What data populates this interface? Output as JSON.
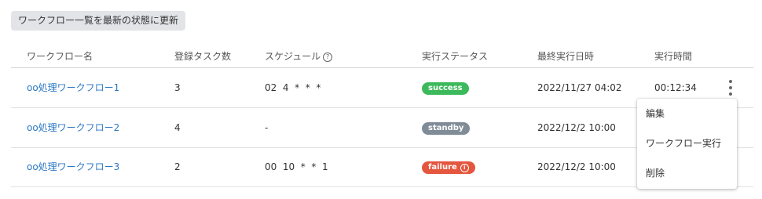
{
  "toolbar": {
    "refresh_label": "ワークフロー一覧を最新の状態に更新"
  },
  "table": {
    "headers": {
      "name": "ワークフロー名",
      "tasks": "登録タスク数",
      "schedule": "スケジュール",
      "status": "実行ステータス",
      "last_run": "最終実行日時",
      "duration": "実行時間"
    },
    "rows": [
      {
        "name": "oo処理ワークフロー1",
        "tasks": "3",
        "schedule": "02  4  *  *  *",
        "status": "success",
        "last_run": "2022/11/27 04:02",
        "duration": "00:12:34"
      },
      {
        "name": "oo処理ワークフロー2",
        "tasks": "4",
        "schedule": "-",
        "status": "standby",
        "last_run": "2022/12/2 10:00",
        "duration": ""
      },
      {
        "name": "oo処理ワークフロー3",
        "tasks": "2",
        "schedule": "00  10  *  *  1",
        "status": "failure",
        "last_run": "2022/12/2 10:00",
        "duration": ""
      }
    ]
  },
  "context_menu": {
    "items": [
      {
        "label": "編集"
      },
      {
        "label": "ワークフロー実行"
      },
      {
        "label": "削除"
      }
    ]
  },
  "colors": {
    "link": "#2b78c5",
    "success": "#3cb95b",
    "standby": "#7f8c97",
    "failure": "#e4563e"
  },
  "icons": {
    "schedule_help": "question-circle-icon",
    "failure_info": "info-circle-icon",
    "row_menu": "kebab-vertical-icon"
  }
}
